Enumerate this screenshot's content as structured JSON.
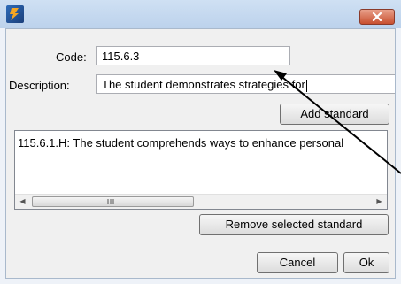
{
  "window": {
    "close_glyph": "✕",
    "app_icon": "app-logo-icon"
  },
  "form": {
    "code_label": "Code:",
    "code_value": "115.6.3",
    "description_label": "Description:",
    "description_value": "The student demonstrates strategies for",
    "add_standard_label": "Add standard",
    "remove_selected_label": "Remove selected standard",
    "cancel_label": "Cancel",
    "ok_label": "Ok"
  },
  "standards_list": {
    "items": [
      "115.6.1.H: The student comprehends ways to enhance personal"
    ],
    "scroll_left": "◀",
    "scroll_right": "▶"
  },
  "colors": {
    "titlebar": "#c4d7ef",
    "close_button": "#c8502f",
    "client_bg": "#f0f0f0",
    "annotation_arrow": "#000000"
  }
}
